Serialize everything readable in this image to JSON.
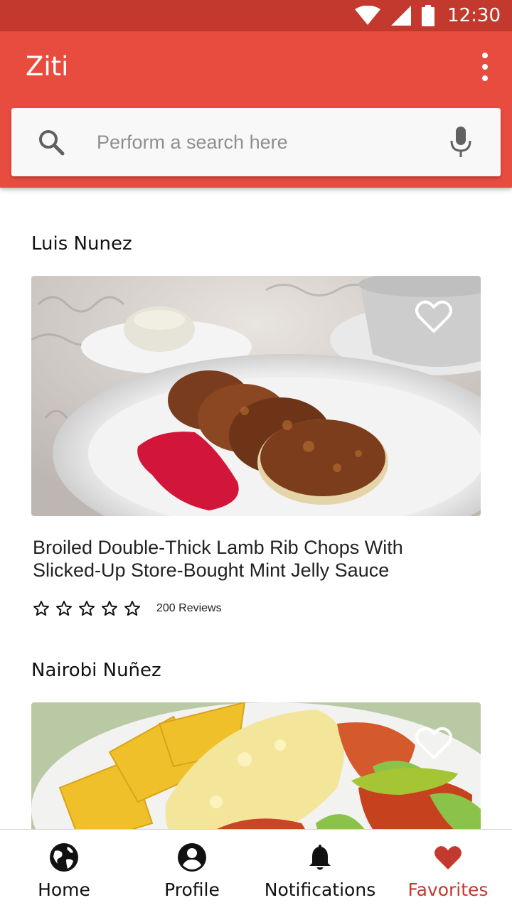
{
  "status_bar": {
    "time": "12:30",
    "icons": [
      "wifi-icon",
      "cellular-signal-icon",
      "battery-icon"
    ]
  },
  "app_bar": {
    "title": "Ziti",
    "overflow_icon": "more-vert-icon"
  },
  "search": {
    "placeholder": "Perform a search here",
    "value": "",
    "search_icon": "search-icon",
    "mic_icon": "mic-icon"
  },
  "feed": {
    "cards": [
      {
        "author": "Luis Nunez",
        "title_line1": "Broiled Double-Thick Lamb Rib Chops With",
        "title_line2": "Slicked-Up Store-Bought Mint Jelly Sauce",
        "stars": 0,
        "max_stars": 5,
        "reviews": "200 Reviews",
        "favorite": false
      },
      {
        "author": "Nairobi Nuñez",
        "favorite": false
      }
    ]
  },
  "bottom_nav": {
    "items": [
      {
        "label": "Home",
        "icon": "globe-icon",
        "active": false
      },
      {
        "label": "Profile",
        "icon": "account-circle-icon",
        "active": false
      },
      {
        "label": "Notifications",
        "icon": "bell-icon",
        "active": false
      },
      {
        "label": "Favorites",
        "icon": "heart-icon",
        "active": true
      }
    ]
  },
  "colors": {
    "status_bar": "#c4392e",
    "app_bar": "#e84c3f",
    "accent": "#c4392e",
    "search_bg": "#f8f8f8"
  }
}
